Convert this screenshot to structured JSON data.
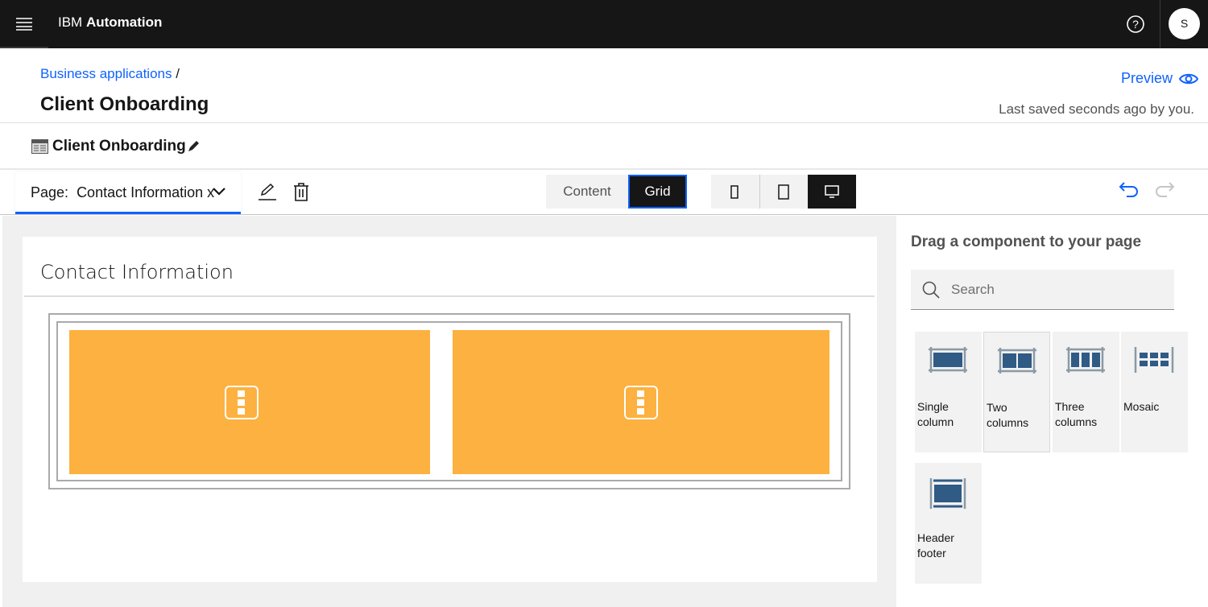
{
  "header": {
    "brand_prefix": "IBM",
    "brand_name": "Automation",
    "avatar_initial": "S"
  },
  "breadcrumb": {
    "parent": "Business applications",
    "separator": "/"
  },
  "page_title": "Client Onboarding",
  "preview_label": "Preview",
  "save_status": "Last saved seconds ago by you.",
  "app_name": "Client Onboarding",
  "toolbar": {
    "page_label": "Page:",
    "page_value": "Contact Information x",
    "mode_content": "Content",
    "mode_grid": "Grid",
    "active_mode": "Grid",
    "active_device": "desktop"
  },
  "canvas": {
    "section_title": "Contact Information"
  },
  "palette": {
    "title": "Drag a component to your page",
    "search_placeholder": "Search",
    "items": [
      {
        "label": "Single column"
      },
      {
        "label": "Two columns"
      },
      {
        "label": "Three columns"
      },
      {
        "label": "Mosaic"
      },
      {
        "label": "Header footer"
      }
    ]
  },
  "colors": {
    "accent": "#0f62fe",
    "cell": "#fdb140",
    "topbar": "#161616"
  }
}
